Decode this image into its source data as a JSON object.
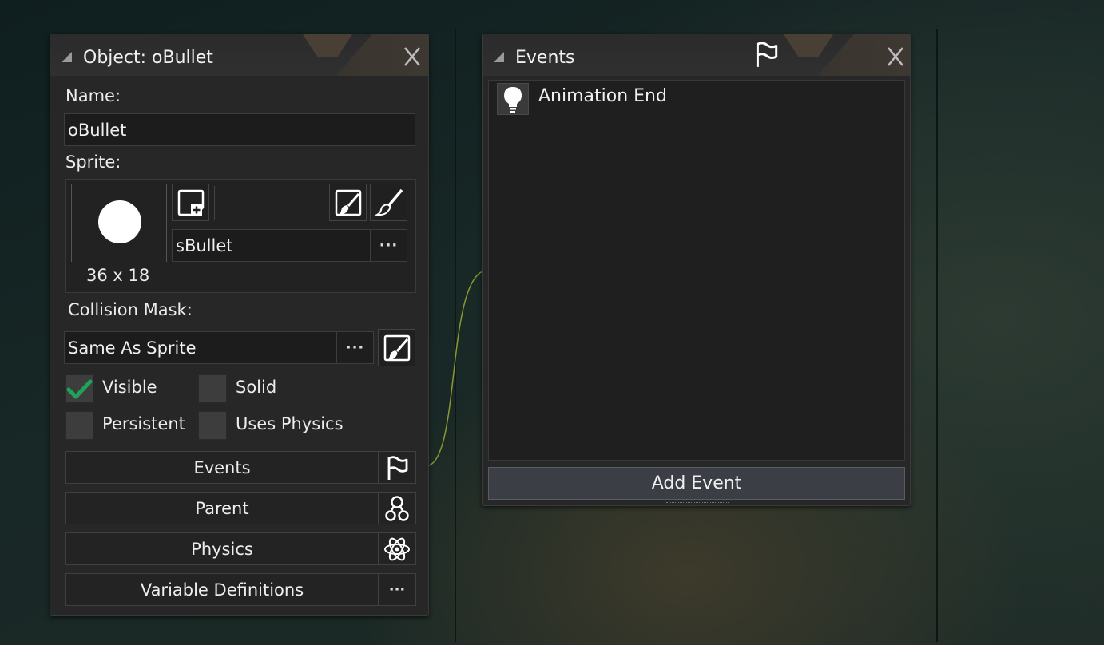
{
  "object_panel": {
    "title": "Object: oBullet",
    "name_label": "Name:",
    "name_value": "oBullet",
    "sprite_label": "Sprite:",
    "sprite_size": "36 x 18",
    "sprite_name": "sBullet",
    "more_label": "···",
    "collision_label": "Collision Mask:",
    "collision_value": "Same As Sprite",
    "checkboxes": {
      "visible": {
        "label": "Visible",
        "checked": true
      },
      "solid": {
        "label": "Solid",
        "checked": false
      },
      "persistent": {
        "label": "Persistent",
        "checked": false
      },
      "uses_physics": {
        "label": "Uses Physics",
        "checked": false
      }
    },
    "buttons": {
      "events": "Events",
      "parent": "Parent",
      "physics": "Physics",
      "variable_definitions": "Variable Definitions"
    }
  },
  "events_panel": {
    "title": "Events",
    "events": [
      {
        "label": "Animation End",
        "icon": "lightbulb-icon"
      }
    ],
    "add_event": "Add Event"
  },
  "colors": {
    "check_green": "#1fa35a",
    "wire": "#8a9a2e"
  }
}
